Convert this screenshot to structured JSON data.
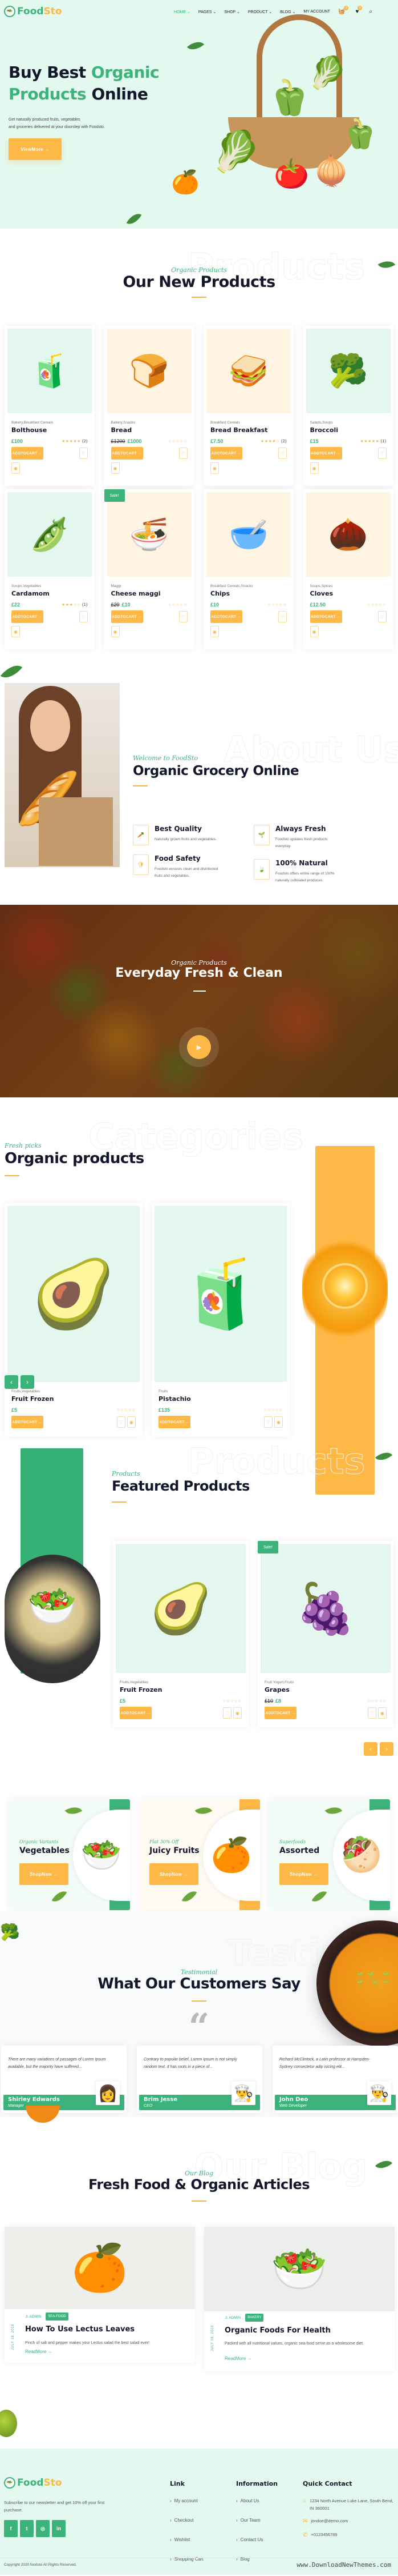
{
  "brand": {
    "name_part1": "Food",
    "name_part2": "Sto"
  },
  "nav": {
    "items": [
      {
        "label": "HOME",
        "active": true,
        "caret": "⌄"
      },
      {
        "label": "PAGES",
        "caret": "⌄"
      },
      {
        "label": "SHOP",
        "caret": "⌄"
      },
      {
        "label": "PRODUCT",
        "caret": "⌄"
      },
      {
        "label": "BLOG",
        "caret": "⌄"
      },
      {
        "label": "MY ACCOUNT"
      }
    ],
    "cart_count": "0",
    "wishlist_count": "0",
    "icons": [
      "basket-icon",
      "heart-icon",
      "search-icon"
    ]
  },
  "hero": {
    "title_line1_a": "Buy Best ",
    "title_line1_b": "Organic",
    "title_line2_a": "Products",
    "title_line2_b": " Online",
    "subtitle_line1": "Get naturally produced fruits, vegetables",
    "subtitle_line2": "and groceries delivered at your doorstep with Foodsto.",
    "button": "ViewMore →"
  },
  "new_products": {
    "ghost": "Products",
    "kicker": "Organic Products",
    "title": "Our New Products",
    "add_to_cart": "ADDTOCART →",
    "items": [
      {
        "category": "Bakery,Breakfast Cereals",
        "name": "Bolthouse",
        "old_price": "",
        "price": "£100",
        "stars": "★★★★★",
        "count": "(2)",
        "bg": "mint",
        "emoji": "🧃",
        "sale": ""
      },
      {
        "category": "Bakery,Snacks",
        "name": "Bread",
        "old_price": "£1200",
        "price": "£1000",
        "stars": "☆☆☆☆☆",
        "count": "",
        "bg": "cream",
        "emoji": "🍞",
        "sale": ""
      },
      {
        "category": "Breakfast Cereals",
        "name": "Bread Breakfast",
        "old_price": "",
        "price": "£7.50",
        "stars": "★★★★☆",
        "count": "(2)",
        "bg": "cream",
        "emoji": "🥪",
        "sale": ""
      },
      {
        "category": "Salads,Soups",
        "name": "Broccoli",
        "old_price": "",
        "price": "£15",
        "stars": "★★★★★",
        "count": "(1)",
        "bg": "mint",
        "emoji": "🥦",
        "sale": ""
      },
      {
        "category": "Soups,Vegetables",
        "name": "Cardamom",
        "old_price": "",
        "price": "£22",
        "stars": "★★★☆☆",
        "count": "(1)",
        "bg": "mint",
        "emoji": "🫛",
        "sale": ""
      },
      {
        "category": "Maggi",
        "name": "Cheese maggi",
        "old_price": "£20",
        "price": "£10",
        "stars": "☆☆☆☆☆",
        "count": "",
        "bg": "cream",
        "emoji": "🍜",
        "sale": "Sale!"
      },
      {
        "category": "Breakfast Cereals,Snacks",
        "name": "Chips",
        "old_price": "",
        "price": "£10",
        "stars": "☆☆☆☆☆",
        "count": "",
        "bg": "cream",
        "emoji": "🥣",
        "sale": ""
      },
      {
        "category": "Soups,Spices",
        "name": "Cloves",
        "old_price": "",
        "price": "£12.50",
        "stars": "☆☆☆☆☆",
        "count": "",
        "bg": "cream",
        "emoji": "🌰",
        "sale": ""
      }
    ]
  },
  "about": {
    "ghost": "About Us",
    "kicker": "Welcome to FoodSto",
    "title": "Organic Grocery Online",
    "features": [
      {
        "title": "Best Quality",
        "text": "Naturally grown fruits and vegetables.",
        "icon": "🥕"
      },
      {
        "title": "Always Fresh",
        "text": "Foodsto updates fresh products everyday.",
        "icon": "🌱"
      },
      {
        "title": "Food Safety",
        "text": "Foodsto ensures clean and disinfected fruits and vegetables.",
        "icon": "🛡"
      },
      {
        "title": "100% Natural",
        "text": "Foodsto offers entire range of 100% naturally cultivated produces.",
        "icon": "🍃"
      }
    ]
  },
  "video": {
    "kicker": "Organic Products",
    "title": "Everyday Fresh & Clean",
    "play": "▶"
  },
  "categories": {
    "ghost": "Categories",
    "kicker": "Fresh picks",
    "title": "Organic products",
    "add_to_cart": "ADDTOCART →",
    "items": [
      {
        "category": "Fruits,Vegetables",
        "name": "Fruit Frozen",
        "price": "£5",
        "stars": "☆☆☆☆☆",
        "emoji": "🥑"
      },
      {
        "category": "Fruits",
        "name": "Pistachio",
        "price": "£135",
        "stars": "☆☆☆☆☆",
        "emoji": "🧃"
      }
    ],
    "prev": "‹",
    "next": "›"
  },
  "featured": {
    "ghost": "Products",
    "kicker": "Products",
    "title": "Featured Products",
    "add_to_cart": "ADDTOCART →",
    "items": [
      {
        "category": "Fruits,Vegetables",
        "name": "Fruit Frozen",
        "old_price": "",
        "price": "£5",
        "stars": "☆☆☆☆☆",
        "emoji": "🥑",
        "sale": ""
      },
      {
        "category": "Fruit Yogurt,Fruits",
        "name": "Grapes",
        "old_price": "£10",
        "price": "£8",
        "stars": "☆☆☆☆☆",
        "emoji": "🍇",
        "sale": "Sale!"
      }
    ],
    "prev": "‹",
    "next": "›"
  },
  "banners": [
    {
      "kicker": "Organic Variants",
      "title": "Vegetables",
      "button": "ShopNow →",
      "accent": "#3cb37a",
      "emoji": "🥗",
      "bg": "#f4fcf8"
    },
    {
      "kicker": "Flat 30% Off",
      "title": "Juicy Fruits",
      "button": "ShopNow →",
      "accent": "#fdb845",
      "emoji": "🍊",
      "bg": "#fffaf2"
    },
    {
      "kicker": "Superfoods",
      "title": "Assorted",
      "button": "ShopNow →",
      "accent": "#3cb37a",
      "emoji": "🥙",
      "bg": "#f4fcf8"
    }
  ],
  "testimonials": {
    "ghost": "Testim",
    "kicker": "Testimonial",
    "title": "What Our Customers Say",
    "quote_mark": "“",
    "items": [
      {
        "text": "There are many variations of passages of Lorem Ipsum available, but the majority have suffered...",
        "name": "Shirley Edwards",
        "role": "Manager",
        "avatar": "👩"
      },
      {
        "text": "Contrary to popular belief, Lorem Ipsum is not simply random text. It has roots in a piece of...",
        "name": "Brim Jesse",
        "role": "CEO",
        "avatar": "👨‍🍳"
      },
      {
        "text": "Richard McClintock, a Latin professor at Hampden-Sydney consectetur adip isicing elit...",
        "name": "John Deo",
        "role": "Web Developer",
        "avatar": "👨‍🍳"
      }
    ]
  },
  "blog": {
    "ghost": "Our Blog",
    "kicker": "Our Blog",
    "title": "Fresh Food & Organic Articles",
    "posts": [
      {
        "date": "JULY 18, 2019",
        "author": "ADMIN",
        "tag": "SEA-FOOD",
        "title": "How To Use Lectus Leaves",
        "text": "Pinch of salt and pepper makes your Lectus salad the best salad ever!",
        "read_more": "ReadMore →",
        "emoji": "🍊"
      },
      {
        "date": "JULY 18, 2019",
        "author": "ADMIN",
        "tag": "BAKERY",
        "title": "Organic Foods For Health",
        "text": "Packed with all nutritional values, organic sea-food serve as a wholesome diet.",
        "read_more": "ReadMore →",
        "emoji": "🥗"
      }
    ]
  },
  "footer": {
    "newsletter": "Subscribe to our newsletter and get 10% off your first purchase.",
    "social": [
      {
        "name": "facebook",
        "glyph": "f"
      },
      {
        "name": "twitter",
        "glyph": "t"
      },
      {
        "name": "instagram",
        "glyph": "◎"
      },
      {
        "name": "linkedin",
        "glyph": "in"
      }
    ],
    "link_title": "Link",
    "links": [
      "My account",
      "Checkout",
      "Wishlist",
      "Shopping Cart"
    ],
    "info_title": "Information",
    "info": [
      "About Us",
      "Our Team",
      "Contact Us",
      "Blog"
    ],
    "contact_title": "Quick Contact",
    "address": "1234 North Avenue Luke Lane, South Bend, IN 360001",
    "email": "jondoe@demo.com",
    "phone": "+0123456789",
    "copyright": "Copyright 2020 foodsto All Rights Reserved.",
    "watermark": "www.DownloadNewThemes.com"
  },
  "colors": {
    "green": "#3cb37a",
    "orange": "#fdb845",
    "mint": "#e3f7ee",
    "dark": "#14172b"
  }
}
